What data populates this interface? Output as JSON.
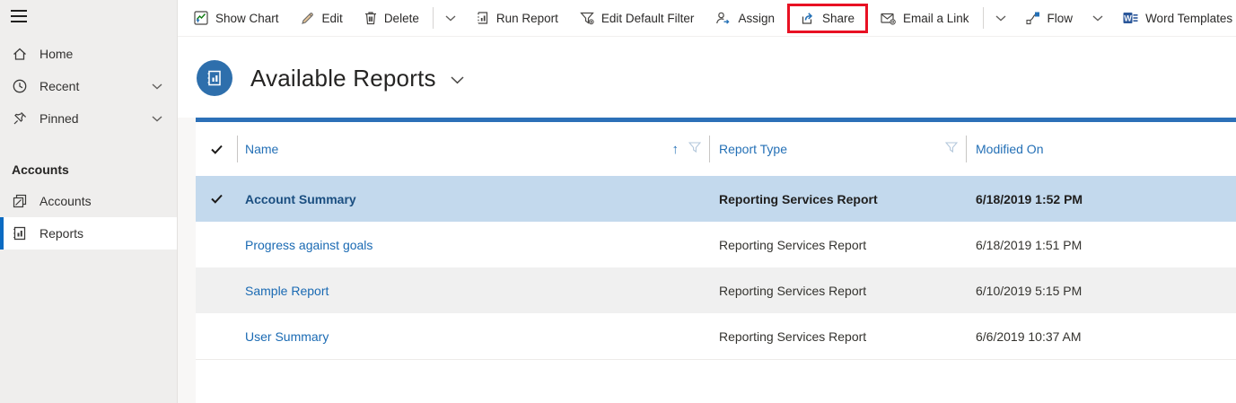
{
  "colors": {
    "accent_blue": "#2470b6",
    "grid_top_bar": "#2c70b8",
    "selected_row_bg": "#c3d9ed",
    "selected_row_link": "#1a4e80",
    "link_blue": "#1a6ab3",
    "alt_row_bg": "#f0f0f0",
    "sidebar_bg": "#efeeed",
    "sidebar_selected_bar": "#0b6bc2",
    "entity_icon_bg": "#2e6fac",
    "highlight_box_red": "#e81123",
    "word_icon_blue": "#2b579a",
    "chart_icon_green": "#107c10"
  },
  "sidebar": {
    "menu_icon": "hamburger-icon",
    "items_top": [
      {
        "label": "Home",
        "icon": "home-icon",
        "has_chevron": false
      },
      {
        "label": "Recent",
        "icon": "clock-icon",
        "has_chevron": true
      },
      {
        "label": "Pinned",
        "icon": "pin-icon",
        "has_chevron": true
      }
    ],
    "group_header": "Accounts",
    "group_items": [
      {
        "label": "Accounts",
        "icon": "accounts-icon",
        "selected": false
      },
      {
        "label": "Reports",
        "icon": "reports-icon",
        "selected": true
      }
    ]
  },
  "toolbar": {
    "buttons": [
      {
        "label": "Show Chart",
        "icon": "show-chart-icon"
      },
      {
        "label": "Edit",
        "icon": "pencil-icon"
      },
      {
        "label": "Delete",
        "icon": "trash-icon"
      },
      {
        "label": "Run Report",
        "icon": "run-report-icon"
      },
      {
        "label": "Edit Default Filter",
        "icon": "filter-settings-icon"
      },
      {
        "label": "Assign",
        "icon": "assign-person-icon"
      },
      {
        "label": "Share",
        "icon": "share-icon",
        "highlighted": true
      },
      {
        "label": "Email a Link",
        "icon": "email-icon"
      },
      {
        "label": "Flow",
        "icon": "flow-icon",
        "has_chevron": true
      },
      {
        "label": "Word Templates",
        "icon": "word-icon",
        "has_chevron": true
      }
    ],
    "annotation": {
      "type": "red-box",
      "around": "Share",
      "color": "#e81123"
    }
  },
  "page": {
    "title": "Available Reports",
    "entity_icon": "report-entity-icon"
  },
  "grid": {
    "columns": [
      {
        "label": "Name",
        "sort": "ascending",
        "has_filter": true
      },
      {
        "label": "Report Type",
        "sort": null,
        "has_filter": true
      },
      {
        "label": "Modified On",
        "sort": null,
        "has_filter": false
      }
    ],
    "rows": [
      {
        "name": "Account Summary",
        "type": "Reporting Services Report",
        "modified": "6/18/2019 1:52 PM",
        "selected": true
      },
      {
        "name": "Progress against goals",
        "type": "Reporting Services Report",
        "modified": "6/18/2019 1:51 PM",
        "selected": false
      },
      {
        "name": "Sample Report",
        "type": "Reporting Services Report",
        "modified": "6/10/2019 5:15 PM",
        "selected": false
      },
      {
        "name": "User Summary",
        "type": "Reporting Services Report",
        "modified": "6/6/2019 10:37 AM",
        "selected": false
      }
    ]
  }
}
